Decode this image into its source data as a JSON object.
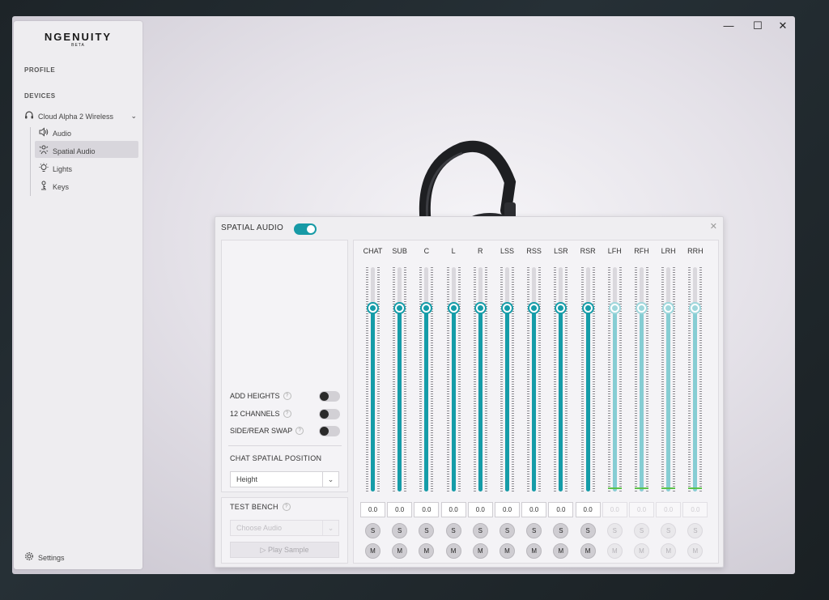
{
  "app": {
    "logo": "NGENUITY",
    "logo_sub": "BETA"
  },
  "window_controls": {
    "minimize": "—",
    "maximize": "☐",
    "close": "✕"
  },
  "sidebar": {
    "profile_header": "PROFILE",
    "devices_header": "DEVICES",
    "device": "Cloud Alpha 2 Wireless",
    "items": [
      {
        "label": "Audio",
        "icon": "speaker-icon"
      },
      {
        "label": "Spatial Audio",
        "icon": "spatial-icon",
        "selected": true
      },
      {
        "label": "Lights",
        "icon": "bulb-icon"
      },
      {
        "label": "Keys",
        "icon": "keys-icon"
      }
    ],
    "settings": "Settings"
  },
  "panel": {
    "title": "SPATIAL AUDIO",
    "enabled": true,
    "options": [
      {
        "label": "ADD HEIGHTS",
        "on": false
      },
      {
        "label": "12 CHANNELS",
        "on": false
      },
      {
        "label": "SIDE/REAR SWAP",
        "on": false
      }
    ],
    "chat_position_header": "CHAT SPATIAL POSITION",
    "chat_position_value": "Height",
    "test_bench_header": "TEST BENCH",
    "choose_audio_placeholder": "Choose Audio",
    "play_sample": "Play Sample"
  },
  "mixer": {
    "accent": "#159ca8",
    "channels": [
      {
        "label": "CHAT",
        "value": "0.0",
        "level": 0.82,
        "active": true
      },
      {
        "label": "SUB",
        "value": "0.0",
        "level": 0.82,
        "active": true
      },
      {
        "label": "C",
        "value": "0.0",
        "level": 0.82,
        "active": true
      },
      {
        "label": "L",
        "value": "0.0",
        "level": 0.82,
        "active": true
      },
      {
        "label": "R",
        "value": "0.0",
        "level": 0.82,
        "active": true
      },
      {
        "label": "LSS",
        "value": "0.0",
        "level": 0.82,
        "active": true
      },
      {
        "label": "RSS",
        "value": "0.0",
        "level": 0.82,
        "active": true
      },
      {
        "label": "LSR",
        "value": "0.0",
        "level": 0.82,
        "active": true
      },
      {
        "label": "RSR",
        "value": "0.0",
        "level": 0.82,
        "active": true
      },
      {
        "label": "LFH",
        "value": "0.0",
        "level": 0.82,
        "active": false
      },
      {
        "label": "RFH",
        "value": "0.0",
        "level": 0.82,
        "active": false
      },
      {
        "label": "LRH",
        "value": "0.0",
        "level": 0.82,
        "active": false
      },
      {
        "label": "RRH",
        "value": "0.0",
        "level": 0.82,
        "active": false
      }
    ],
    "solo_label": "S",
    "mute_label": "M"
  }
}
